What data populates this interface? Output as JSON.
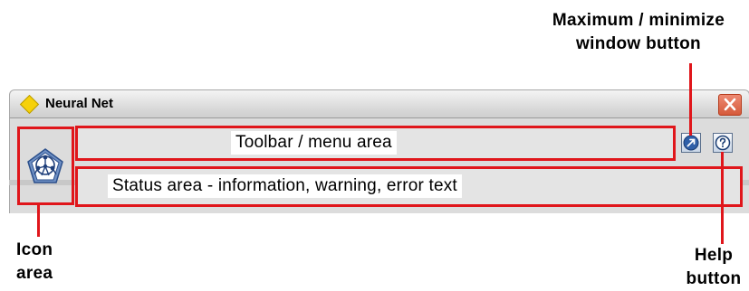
{
  "window": {
    "title": "Neural Net",
    "close_label": "Close"
  },
  "regions": {
    "toolbar_label": "Toolbar / menu area",
    "status_label": "Status area - information, warning, error text"
  },
  "callouts": {
    "max_min_line1": "Maximum / minimize",
    "max_min_line2": "window button",
    "icon_line1": "Icon",
    "icon_line2": "area",
    "help_line1": "Help",
    "help_line2": "button"
  },
  "icons": {
    "title": "diamond-icon",
    "logo": "neural-net-logo-icon",
    "maximize": "maximize-arrow-icon",
    "help": "question-mark-icon",
    "close": "close-x-icon"
  },
  "colors": {
    "highlight": "#e0161b",
    "close_button": "#d55a3b",
    "window_body": "#dcdcdc"
  }
}
